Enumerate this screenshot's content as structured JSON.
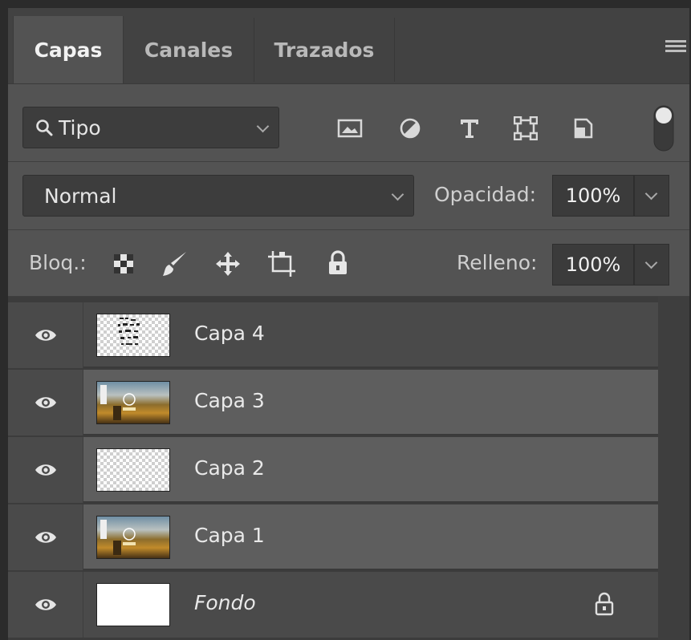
{
  "tabs": [
    {
      "label": "Capas",
      "active": true
    },
    {
      "label": "Canales",
      "active": false
    },
    {
      "label": "Trazados",
      "active": false
    }
  ],
  "filter": {
    "selected": "Tipo",
    "icons": [
      "image-filter-icon",
      "adjustment-filter-icon",
      "type-filter-icon",
      "shape-filter-icon",
      "smart-object-filter-icon"
    ]
  },
  "blend": {
    "mode": "Normal",
    "opacity_label": "Opacidad:",
    "opacity_value": "100%"
  },
  "lock": {
    "label": "Bloq.:",
    "icons": [
      "lock-transparent-pixels-icon",
      "lock-image-pixels-icon",
      "lock-position-icon",
      "lock-artboard-icon",
      "lock-all-icon"
    ],
    "fill_label": "Relleno:",
    "fill_value": "100%"
  },
  "layers": [
    {
      "name": "Capa 4",
      "thumb": "checker-text",
      "visible": true,
      "selected": false,
      "locked": false,
      "italic": false
    },
    {
      "name": "Capa 3",
      "thumb": "photo",
      "visible": true,
      "selected": true,
      "locked": false,
      "italic": false
    },
    {
      "name": "Capa 2",
      "thumb": "checker",
      "visible": true,
      "selected": true,
      "locked": false,
      "italic": false
    },
    {
      "name": "Capa 1",
      "thumb": "photo",
      "visible": true,
      "selected": true,
      "locked": false,
      "italic": false
    },
    {
      "name": "Fondo",
      "thumb": "white",
      "visible": true,
      "selected": false,
      "locked": true,
      "italic": true
    }
  ],
  "colors": {
    "panel": "#535353",
    "tabbar": "#424242",
    "selected_layer": "#5e5e5e",
    "unselected_layer": "#4a4a4a",
    "text": "#e9e9e9"
  }
}
